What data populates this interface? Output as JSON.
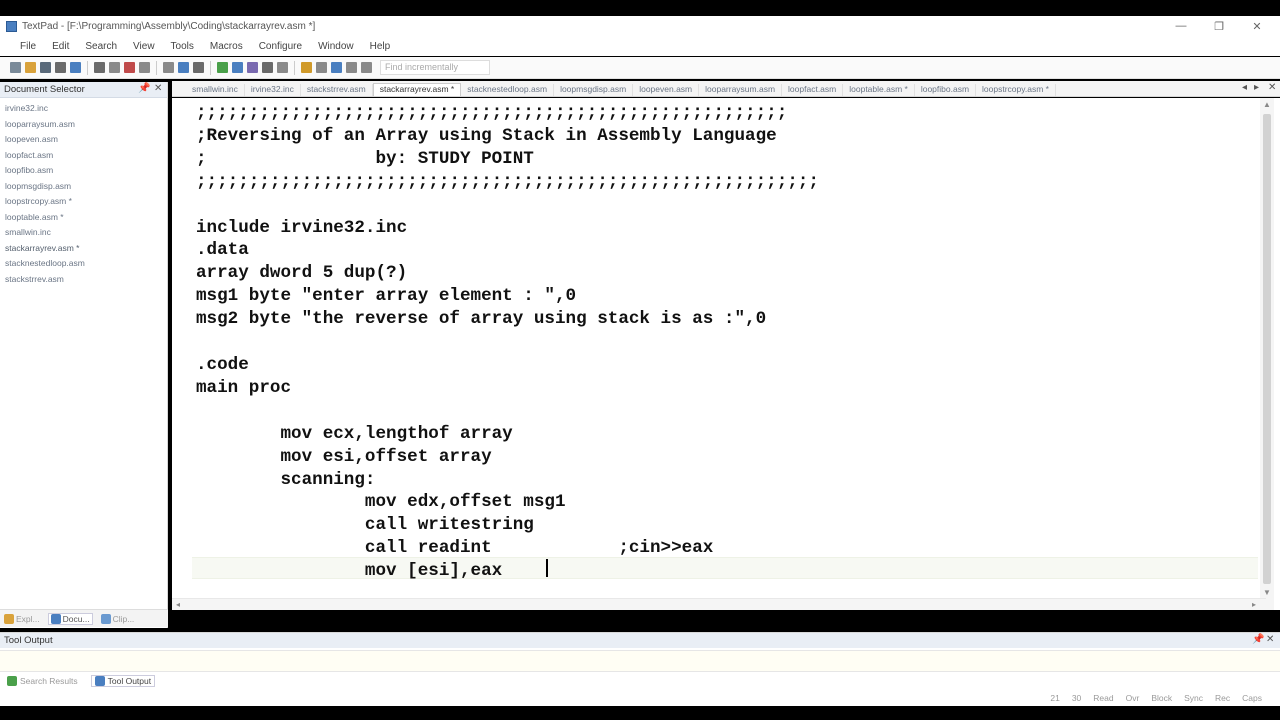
{
  "window": {
    "title": "TextPad - [F:\\Programming\\Assembly\\Coding\\stackarrayrev.asm *]",
    "controls": {
      "minimize": "—",
      "maximize": "❐",
      "close": "✕"
    }
  },
  "menu": [
    "File",
    "Edit",
    "Search",
    "View",
    "Tools",
    "Macros",
    "Configure",
    "Window",
    "Help"
  ],
  "toolbar": {
    "find_placeholder": "Find incrementally",
    "icon_colors": [
      "#7a8a99",
      "#d9a23b",
      "#5a6a7a",
      "#6a6a6a",
      "#4a7fc0",
      "#6a6a6a",
      "#8a8a8a",
      "#c04a4a",
      "#8a8a8a",
      "#8a8a8a",
      "#4a7fc0",
      "#6a6a6a",
      "#4aa04a",
      "#4a7fc0",
      "#7a6ab0",
      "#6a6a6a",
      "#8a8a8a",
      "#d09a2a",
      "#8a8a8a",
      "#4a7fc0",
      "#8a8a8a",
      "#8a8a8a"
    ]
  },
  "document_selector": {
    "title": "Document Selector",
    "pin": "📌",
    "close": "✕",
    "files": [
      "irvine32.inc",
      "looparraysum.asm",
      "loopeven.asm",
      "loopfact.asm",
      "loopfibo.asm",
      "loopmsgdisp.asm",
      "loopstrcopy.asm *",
      "looptable.asm *",
      "smallwin.inc",
      "stackarrayrev.asm *",
      "stacknestedloop.asm",
      "stackstrrev.asm"
    ],
    "active_index": 9,
    "bottom_tabs": [
      {
        "label": "Expl...",
        "color": "#d9a23b"
      },
      {
        "label": "Docu...",
        "color": "#4a7fc0"
      },
      {
        "label": "Clip...",
        "color": "#6a9ad0"
      }
    ]
  },
  "doc_tabs": {
    "tabs": [
      "smallwin.inc",
      "irvine32.inc",
      "stackstrrev.asm",
      "stackarrayrev.asm *",
      "stacknestedloop.asm",
      "loopmsgdisp.asm",
      "loopeven.asm",
      "looparraysum.asm",
      "loopfact.asm",
      "looptable.asm *",
      "loopfibo.asm",
      "loopstrcopy.asm *"
    ],
    "active_index": 3,
    "nav_left": "◂",
    "nav_right": "▸",
    "close": "✕"
  },
  "editor": {
    "code": ";;;;;;;;;;;;;;;;;;;;;;;;;;;;;;;;;;;;;;;;;;;;;;;;;;;;;;;;\n;Reversing of an Array using Stack in Assembly Language\n;                by: STUDY POINT\n;;;;;;;;;;;;;;;;;;;;;;;;;;;;;;;;;;;;;;;;;;;;;;;;;;;;;;;;;;;\n\ninclude irvine32.inc\n.data\narray dword 5 dup(?)\nmsg1 byte \"enter array element : \",0\nmsg2 byte \"the reverse of array using stack is as :\",0\n\n.code\nmain proc\n\n        mov ecx,lengthof array\n        mov esi,offset array\n        scanning:\n                mov edx,offset msg1\n                call writestring\n                call readint            ;cin>>eax\n                mov [esi],eax",
    "scroll_up": "▲",
    "scroll_down": "▼",
    "scroll_left": "◂",
    "scroll_right": "▸"
  },
  "tool_output": {
    "title": "Tool Output",
    "pin": "📌",
    "close": "✕",
    "tabs": [
      {
        "label": "Search Results",
        "color": "#4aa04a"
      },
      {
        "label": "Tool Output",
        "color": "#4a7fc0"
      }
    ],
    "active_index": 1
  },
  "status": {
    "line": "21",
    "column": "30",
    "read": "Read",
    "ovr": "Ovr",
    "block": "Block",
    "sync": "Sync",
    "rec": "Rec",
    "caps": "Caps"
  }
}
